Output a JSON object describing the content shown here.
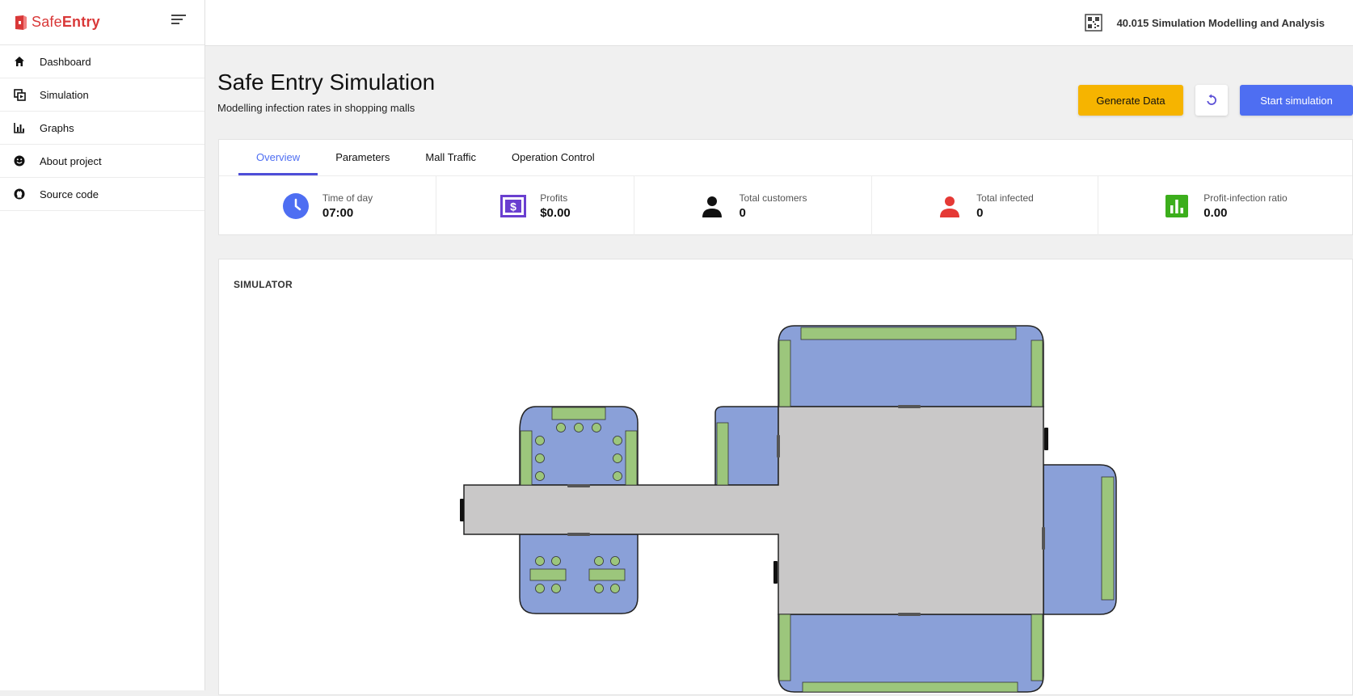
{
  "brand": {
    "name_light": "Safe",
    "name_bold": "Entry"
  },
  "sidebar": {
    "items": [
      {
        "label": "Dashboard",
        "icon": "home-icon"
      },
      {
        "label": "Simulation",
        "icon": "simulation-icon"
      },
      {
        "label": "Graphs",
        "icon": "bar-chart-icon"
      },
      {
        "label": "About project",
        "icon": "smile-icon"
      },
      {
        "label": "Source code",
        "icon": "github-icon"
      }
    ]
  },
  "header": {
    "course": "40.015 Simulation Modelling and Analysis"
  },
  "page": {
    "title": "Safe Entry Simulation",
    "subtitle": "Modelling infection rates in shopping malls"
  },
  "actions": {
    "generate": "Generate Data",
    "start": "Start simulation"
  },
  "tabs": [
    "Overview",
    "Parameters",
    "Mall Traffic",
    "Operation Control"
  ],
  "stats": [
    {
      "label": "Time of day",
      "value": "07:00",
      "color": "#4e6ef2",
      "icon": "clock-icon"
    },
    {
      "label": "Profits",
      "value": "$0.00",
      "color": "#6a3fd0",
      "icon": "dollar-icon"
    },
    {
      "label": "Total customers",
      "value": "0",
      "color": "#111111",
      "icon": "person-icon"
    },
    {
      "label": "Total infected",
      "value": "0",
      "color": "#e53935",
      "icon": "person-icon"
    },
    {
      "label": "Profit-infection ratio",
      "value": "0.00",
      "color": "#3cae1c",
      "icon": "chart-icon"
    }
  ],
  "simulator": {
    "title": "SIMULATOR"
  },
  "colors": {
    "shop": "#8aa0d8",
    "corridor": "#c9c8c8",
    "shelf": "#9cc67c",
    "door": "#555555"
  }
}
